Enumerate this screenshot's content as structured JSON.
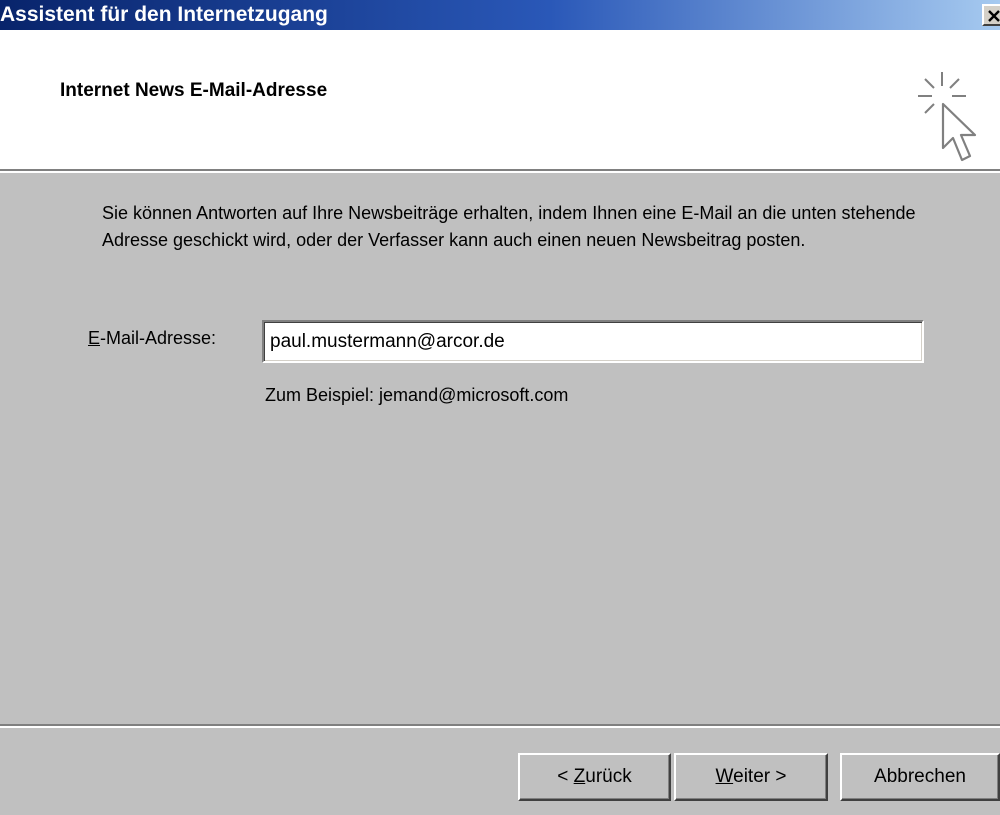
{
  "window": {
    "title": "Assistent für den Internetzugang"
  },
  "header": {
    "title": "Internet News E-Mail-Adresse",
    "icon": "wizard-cursor-sparkle-icon"
  },
  "content": {
    "description": "Sie können Antworten auf Ihre Newsbeiträge erhalten, indem Ihnen eine E-Mail an die unten stehende Adresse geschickt wird, oder der Verfasser kann auch einen neuen Newsbeitrag posten.",
    "email_label_mnemonic": "E",
    "email_label_rest": "-Mail-Adresse:",
    "email_value": "paul.mustermann@arcor.de",
    "example": "Zum Beispiel: jemand@microsoft.com"
  },
  "buttons": {
    "back_prefix": "< ",
    "back_mnemonic": "Z",
    "back_rest": "urück",
    "next_mnemonic": "W",
    "next_rest": "eiter >",
    "cancel": "Abbrechen"
  },
  "colors": {
    "titlebar_start": "#08246b",
    "titlebar_end": "#a6caf0",
    "dialog_bg": "#c0c0c0",
    "header_bg": "#ffffff"
  }
}
